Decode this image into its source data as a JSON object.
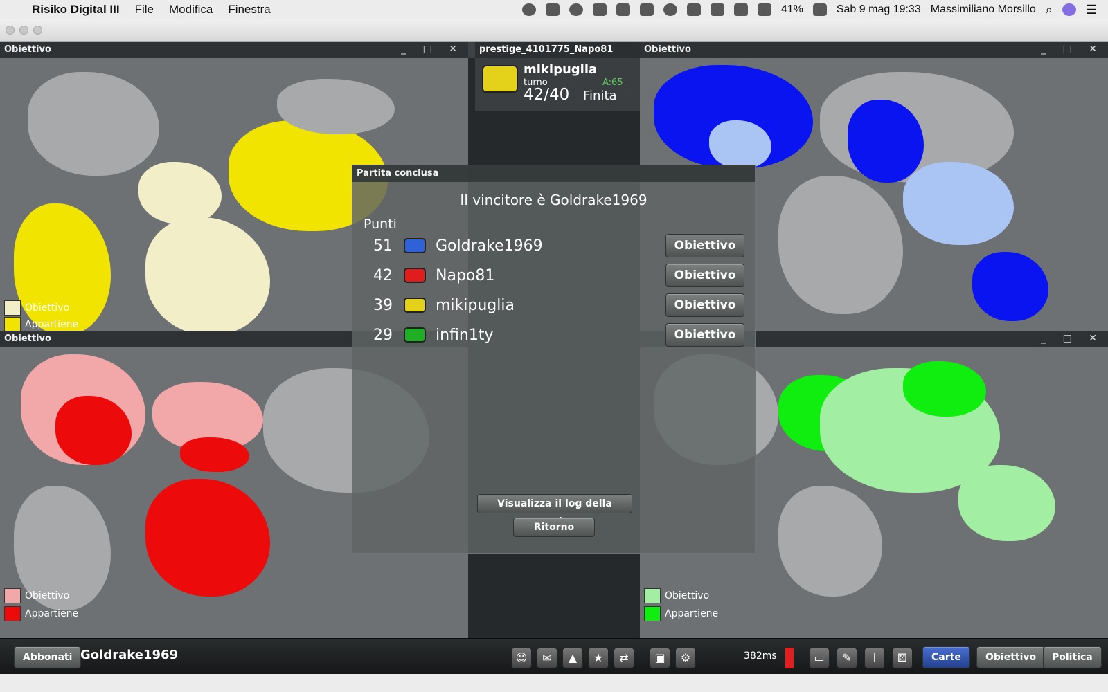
{
  "menubar": {
    "app_name": "Risiko Digital III",
    "menus": [
      "File",
      "Modifica",
      "Finestra"
    ],
    "battery": "41%",
    "datetime": "Sab 9 mag  19:33",
    "user": "Massimiliano Morsillo"
  },
  "panels": {
    "top_left": {
      "title": "Obiettivo",
      "legend_objective": "Obiettivo",
      "legend_owned": "Appartiene",
      "color_objective": "#f2eec8",
      "color_owned": "#f1e400"
    },
    "top_right": {
      "title": "Obiettivo",
      "color_objective": "#aac4f4",
      "color_owned": "#0a14f0"
    },
    "bottom_left": {
      "title": "Obiettivo",
      "legend_objective": "Obiettivo",
      "legend_owned": "Appartiene",
      "color_objective": "#f2a8a8",
      "color_owned": "#ec0a0a"
    },
    "bottom_right": {
      "legend_objective": "Obiettivo",
      "legend_owned": "Appartiene",
      "color_objective": "#a2eea2",
      "color_owned": "#10ee10"
    }
  },
  "center": {
    "title": "prestige_4101775_Napo81",
    "player": "mikipuglia",
    "turn_label": "turno",
    "turn_value": "42/40",
    "status": "Finita",
    "armies": "A:65"
  },
  "dialog": {
    "title": "Partita conclusa",
    "winner_text": "Il vincitore è Goldrake1969",
    "points_header": "Punti",
    "objective_button": "Obiettivo",
    "rows": [
      {
        "score": "51",
        "name": "Goldrake1969",
        "color": "#2e62d6"
      },
      {
        "score": "42",
        "name": "Napo81",
        "color": "#e01c1c"
      },
      {
        "score": "39",
        "name": "mikipuglia",
        "color": "#e4d11a"
      },
      {
        "score": "29",
        "name": "infin1ty",
        "color": "#1fae24"
      }
    ],
    "log_button": "Visualizza il log della partita",
    "return_button": "Ritorno"
  },
  "bottombar": {
    "subscribers_button": "Abbonati",
    "player": "Goldrake1969",
    "ping": "382ms",
    "cards_button": "Carte",
    "objective_button": "Obiettivo",
    "politics_button": "Politica"
  }
}
